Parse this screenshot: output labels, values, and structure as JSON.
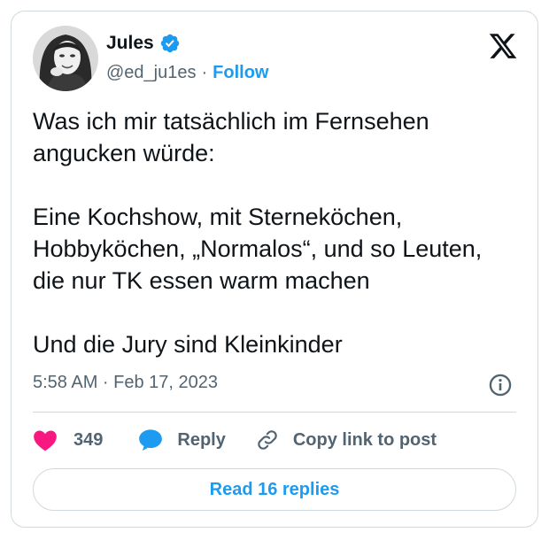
{
  "author": {
    "name": "Jules",
    "handle": "@ed_ju1es",
    "separator": "·",
    "follow_label": "Follow"
  },
  "tweet": {
    "paragraphs": [
      "Was ich mir tatsächlich im Fernsehen angucken würde:",
      "Eine Kochshow, mit Sterneköchen, Hobbyköchen, „Normalos“, und so Leuten, die nur TK essen warm machen",
      "Und die Jury sind Kleinkinder"
    ],
    "timestamp": "5:58 AM · Feb 17, 2023"
  },
  "actions": {
    "like_count": "349",
    "reply_label": "Reply",
    "copy_label": "Copy link to post"
  },
  "footer": {
    "read_replies_label": "Read 16 replies"
  },
  "icons": {
    "verified": "verified-badge-icon",
    "x_logo": "x-logo-icon",
    "info": "info-icon",
    "heart": "heart-icon",
    "reply": "speech-bubble-icon",
    "link": "link-icon"
  },
  "colors": {
    "accent": "#1d9bf0",
    "like": "#f91880",
    "text_primary": "#0f1419",
    "text_secondary": "#536471",
    "border": "#cfd9de"
  }
}
